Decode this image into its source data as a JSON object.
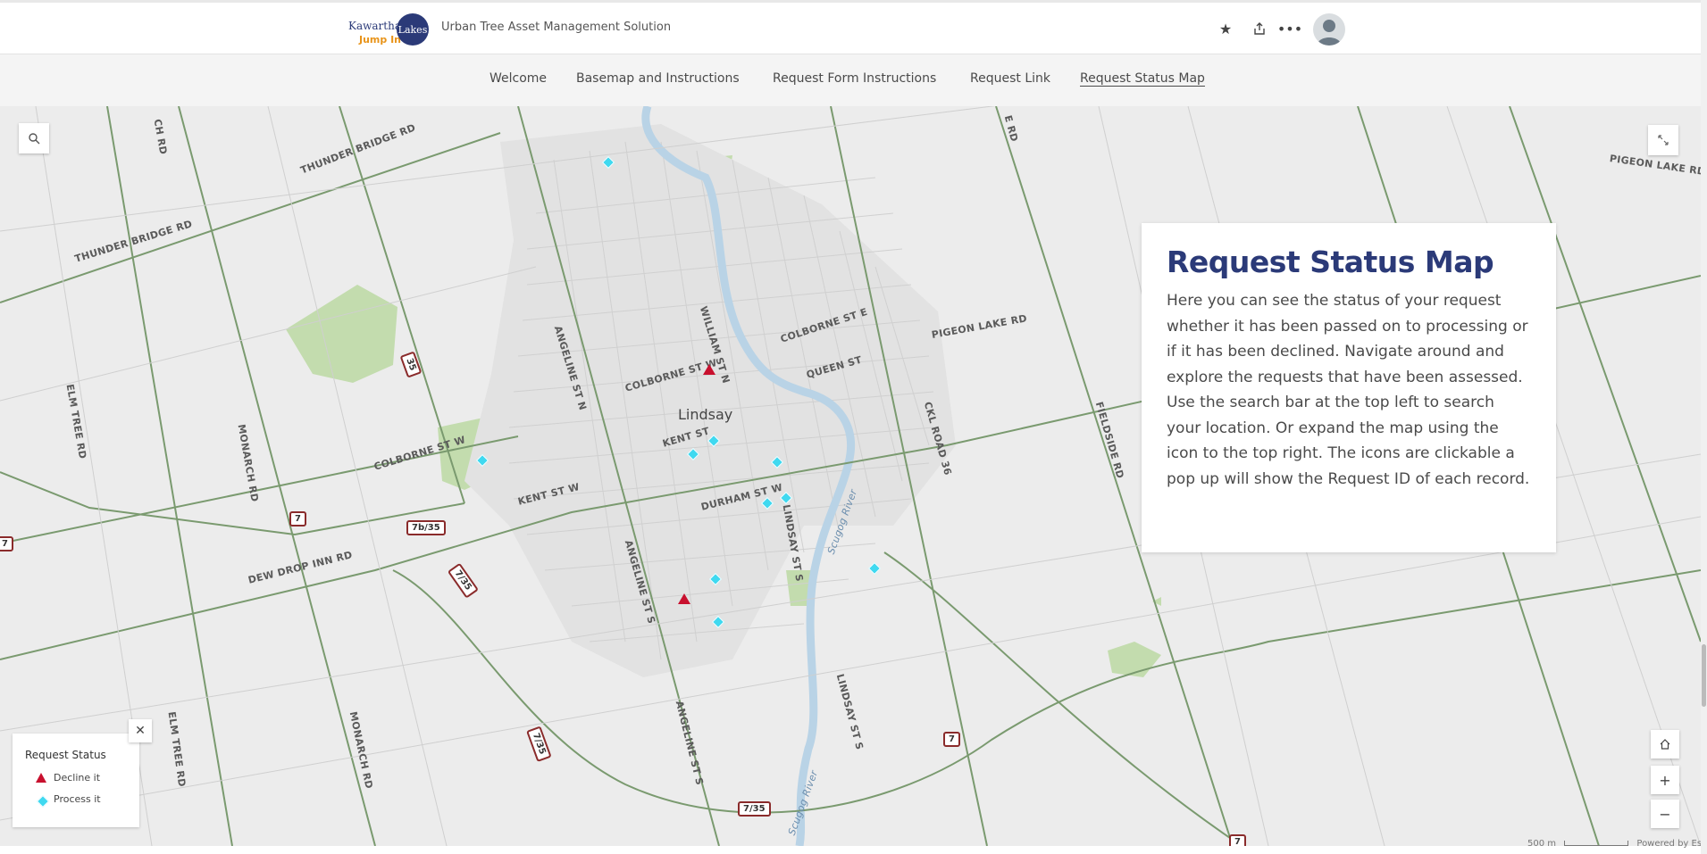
{
  "header": {
    "logo_text_1": "Kawartha",
    "logo_text_2": "Lakes",
    "logo_text_3": "Jump In",
    "app_title": "Urban Tree Asset Management Solution"
  },
  "nav": {
    "items": [
      {
        "label": "Welcome"
      },
      {
        "label": "Basemap and Instructions"
      },
      {
        "label": "Request Form Instructions"
      },
      {
        "label": "Request Link"
      },
      {
        "label": "Request Status Map"
      }
    ]
  },
  "panel": {
    "title": "Request Status Map",
    "body": "Here you can see the status of your request whether it has been passed on to processing or if it has been declined. Navigate around and explore the requests that have been assessed. Use the search bar at the top left to search your location. Or expand the map using the icon to the top right. The icons are clickable a pop up will show the Request ID of each record."
  },
  "legend": {
    "title": "Request Status",
    "items": [
      {
        "label": "Decline it",
        "color": "#c8102e",
        "icon": "triangle-icon"
      },
      {
        "label": "Process it",
        "color": "#3fd9f0",
        "icon": "diamond-icon"
      }
    ]
  },
  "map": {
    "city": "Lindsay",
    "road_labels": [
      "THUNDER BRIDGE RD",
      "THUNDER BRIDGE RD",
      "ELM TREE RD",
      "MONARCH RD",
      "COLBORNE ST W",
      "KENT ST W",
      "DEW DROP INN RD",
      "ANGELINE ST N",
      "WILLIAM ST N",
      "COLBORNE ST E",
      "COLBORNE ST W",
      "QUEEN ST",
      "KENT ST",
      "DURHAM ST W",
      "LINDSAY ST S",
      "ANGELINE ST S",
      "PIGEON LAKE RD",
      "FIELDSIDE RD",
      "CKL ROAD 36",
      "LINDSAY ST S",
      "ELM TREE RD",
      "MONARCH RD",
      "ANGELINE ST S",
      "PIGEON LAKE RD",
      "Scugog River",
      "Scugog River",
      "CH RD",
      "E RD"
    ],
    "shields": [
      "35",
      "7",
      "7b/35",
      "7/35",
      "7",
      "7/35",
      "7/35",
      "7",
      "7"
    ],
    "scale": "500 m",
    "attribution": "Powered by Esri"
  }
}
